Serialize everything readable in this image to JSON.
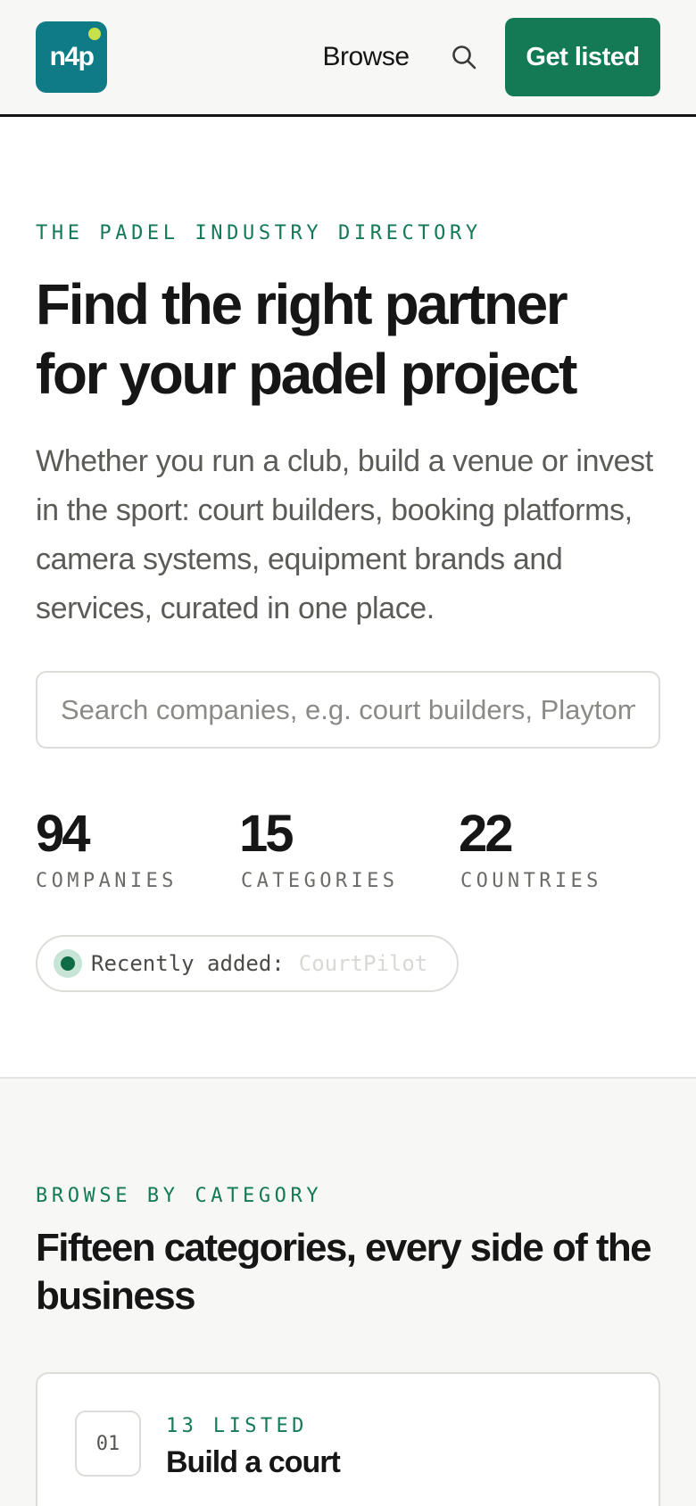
{
  "header": {
    "logo_text": "n4p",
    "nav_browse": "Browse",
    "search_icon": "search-icon",
    "cta_label": "Get listed"
  },
  "colors": {
    "brand_teal": "#0f7b86",
    "accent_green": "#137a55",
    "ball_yellow": "#c9e04d"
  },
  "hero": {
    "eyebrow": "THE PADEL INDUSTRY DIRECTORY",
    "title_line1": "Find the right partner",
    "title_line2": "for your padel project",
    "description": "Whether you run a club, build a venue or invest in the sport: court builders, booking platforms, camera systems, equipment brands and services, curated in one place.",
    "search_placeholder": "Search companies, e.g. court builders, Playtomic"
  },
  "stats": [
    {
      "value": "94",
      "label": "COMPANIES"
    },
    {
      "value": "15",
      "label": "CATEGORIES"
    },
    {
      "value": "22",
      "label": "COUNTRIES"
    }
  ],
  "recent": {
    "label": "Recently added:",
    "name": "CourtPilot"
  },
  "browse": {
    "eyebrow": "BROWSE BY CATEGORY",
    "title": "Fifteen categories, every side of the business",
    "categories": [
      {
        "num": "01",
        "count": "13 LISTED",
        "name": "Build a court"
      }
    ]
  }
}
